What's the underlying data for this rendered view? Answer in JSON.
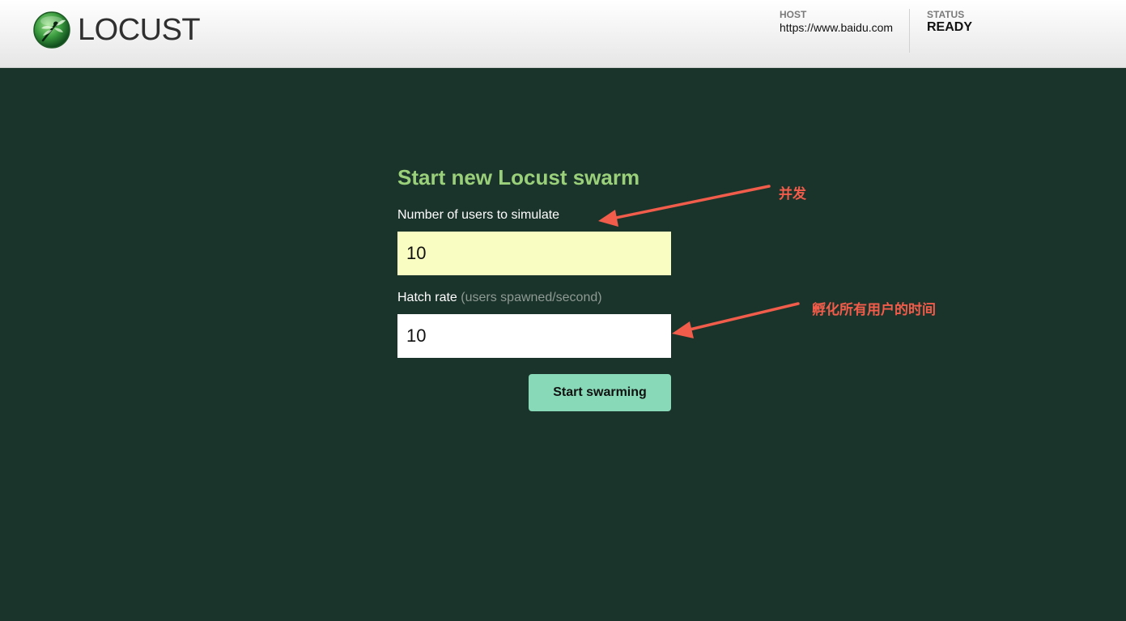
{
  "header": {
    "logo_text": "LOCUST",
    "host_label": "HOST",
    "host_value": "https://www.baidu.com",
    "status_label": "STATUS",
    "status_value": "READY"
  },
  "form": {
    "title": "Start new Locust swarm",
    "users_label": "Number of users to simulate",
    "users_value": "10",
    "hatch_label": "Hatch rate",
    "hatch_hint": "(users spawned/second)",
    "hatch_value": "10",
    "start_button": "Start swarming"
  },
  "annotations": {
    "concurrency": "并发",
    "hatch_time": "孵化所有用户的时间"
  },
  "colors": {
    "background": "#1b342b",
    "title_green": "#9bd07b",
    "users_input_bg": "#fafdc1",
    "button_bg": "#87d9b7",
    "annotation_red": "#f25c4a"
  },
  "icons": {
    "logo": "locust-dragonfly-logo-icon"
  }
}
